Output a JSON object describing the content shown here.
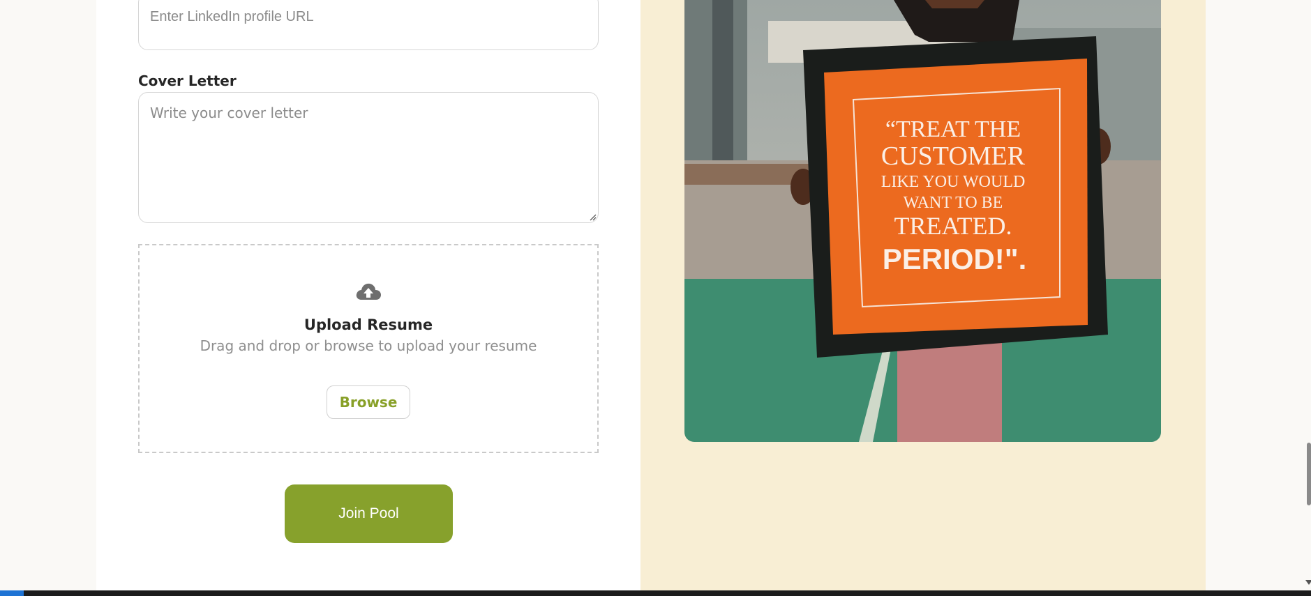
{
  "form": {
    "linkedin_placeholder": "Enter LinkedIn profile URL",
    "cover_letter_label": "Cover Letter",
    "cover_letter_placeholder": "Write your cover letter",
    "upload": {
      "icon": "cloud-upload-icon",
      "title": "Upload Resume",
      "subtitle": "Drag and drop or browse to upload your resume",
      "browse_label": "Browse"
    },
    "submit_label": "Join Pool"
  },
  "side_image": {
    "sign_lines": [
      "“TREAT THE",
      "CUSTOMER",
      "LIKE YOU WOULD",
      "WANT TO BE",
      "TREATED.",
      "PERIOD!\"."
    ]
  },
  "colors": {
    "accent": "#87a12c",
    "side_background": "#f8eed4",
    "sign_orange": "#ec6a1f"
  }
}
